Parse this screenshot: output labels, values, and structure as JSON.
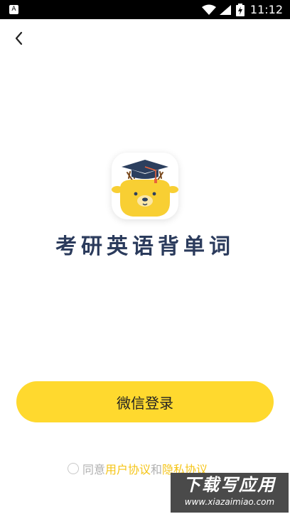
{
  "status_bar": {
    "app_icon_letter": "A",
    "time": "11:12",
    "icons": [
      "wifi-icon",
      "cellular-signal-icon",
      "battery-charging-icon"
    ]
  },
  "nav": {
    "back_icon": "chevron-left-icon"
  },
  "app": {
    "title": "考研英语背单词",
    "logo_icon": "deer-with-graduation-cap-icon"
  },
  "login": {
    "wechat_button_label": "微信登录"
  },
  "agreement": {
    "prefix": "同意",
    "user_agreement": "用户协议",
    "conjunction": "和",
    "privacy_policy": "隐私协议"
  },
  "watermark": {
    "title": "下载写应用",
    "url": "www.xiazaimiao.com"
  },
  "colors": {
    "accent_yellow": "#ffd92e",
    "title_navy": "#2b3b5c",
    "link_yellow": "#f5c518",
    "status_bar": "#000000"
  }
}
